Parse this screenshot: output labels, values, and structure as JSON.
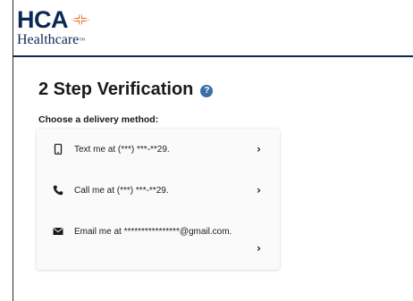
{
  "brand": {
    "name_top": "HCA",
    "name_bottom": "Healthcare",
    "trademark": "™",
    "primary_color": "#0b2a53",
    "accent_color": "#e56a1f"
  },
  "page": {
    "title": "2 Step Verification",
    "help_icon": "help-circle-icon",
    "subtitle": "Choose a delivery method:"
  },
  "delivery_methods": [
    {
      "icon": "mobile-phone-icon",
      "label": "Text me at (***) ***-**29.",
      "action_icon": "chevron-right-icon"
    },
    {
      "icon": "phone-handset-icon",
      "label": "Call me at (***) ***-**29.",
      "action_icon": "chevron-right-icon"
    },
    {
      "icon": "envelope-icon",
      "label": "Email me at ****************@gmail.com.",
      "action_icon": "chevron-right-icon"
    }
  ],
  "ui": {
    "chevron_glyph": "›",
    "help_glyph": "?"
  }
}
